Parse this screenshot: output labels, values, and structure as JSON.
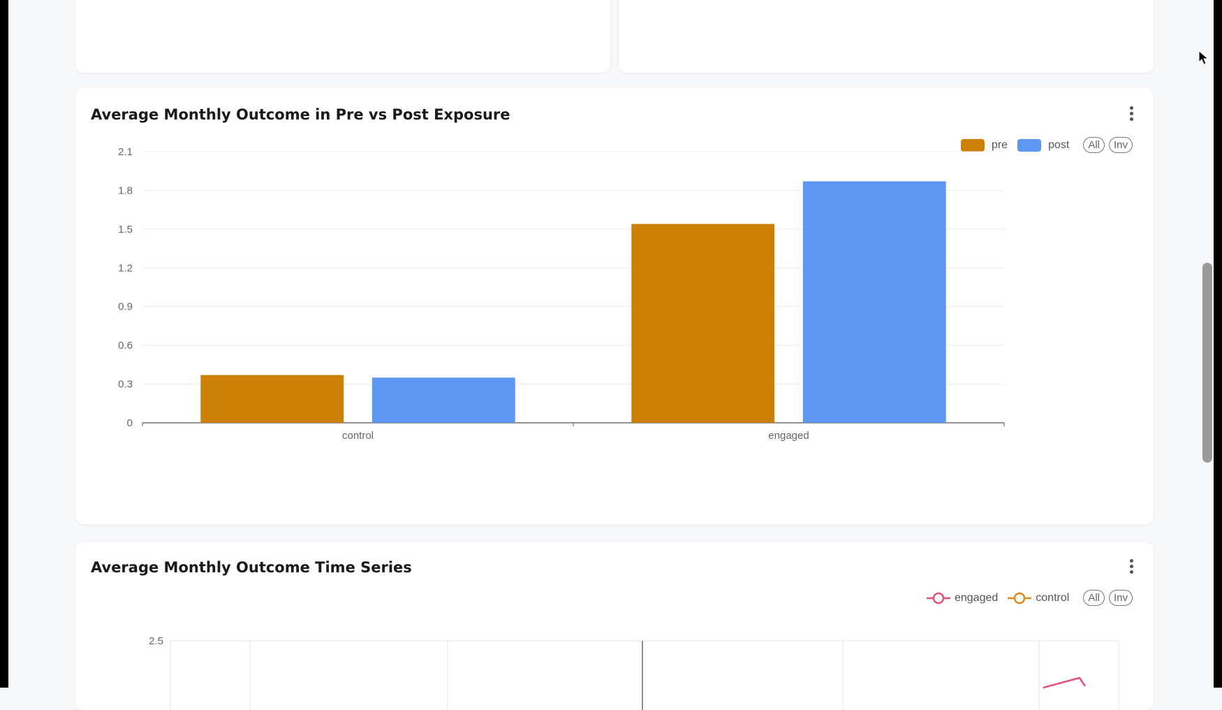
{
  "cards": {
    "bar": {
      "title": "Average Monthly Outcome in Pre vs Post Exposure",
      "legend": [
        {
          "label": "pre",
          "color": "#cc8005"
        },
        {
          "label": "post",
          "color": "#5e97f2"
        }
      ],
      "all_label": "All",
      "inv_label": "Inv"
    },
    "timeseries": {
      "title": "Average Monthly Outcome Time Series",
      "legend": [
        {
          "label": "engaged",
          "color": "#e8507a"
        },
        {
          "label": "control",
          "color": "#d98a18"
        }
      ],
      "all_label": "All",
      "inv_label": "Inv"
    }
  },
  "chart_data": [
    {
      "type": "bar",
      "title": "Average Monthly Outcome in Pre vs Post Exposure",
      "categories": [
        "control",
        "engaged"
      ],
      "series": [
        {
          "name": "pre",
          "values": [
            0.37,
            1.54
          ],
          "color": "#cc8005"
        },
        {
          "name": "post",
          "values": [
            0.35,
            1.87
          ],
          "color": "#5e97f2"
        }
      ],
      "ylim": [
        0,
        2.1
      ],
      "yticks": [
        "0",
        "0.3",
        "0.6",
        "0.9",
        "1.2",
        "1.5",
        "1.8",
        "2.1"
      ],
      "grid": true,
      "legend_position": "top-right"
    },
    {
      "type": "line",
      "title": "Average Monthly Outcome Time Series",
      "yticks": [
        "2.5"
      ],
      "grid": true,
      "legend_position": "top-right"
    }
  ]
}
